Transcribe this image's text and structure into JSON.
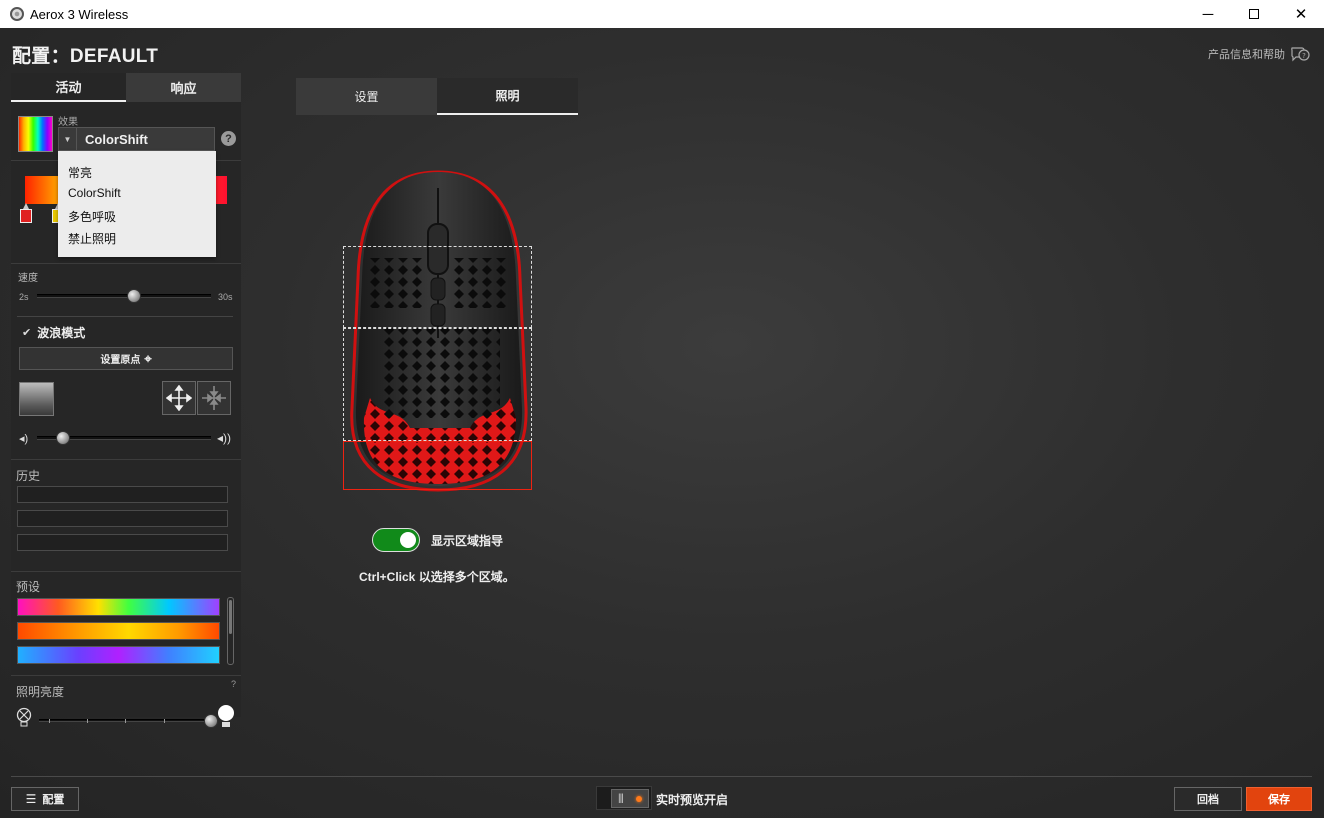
{
  "window": {
    "title": "Aerox 3 Wireless",
    "minimize": "─",
    "close": "✕"
  },
  "header": {
    "profile_title": "配置：DEFAULT",
    "help_link": "产品信息和帮助"
  },
  "left_tabs": [
    {
      "label": "活动",
      "active": true
    },
    {
      "label": "响应",
      "active": false
    }
  ],
  "effect": {
    "label": "效果",
    "selected": "ColorShift",
    "help": "?",
    "options": [
      "常亮",
      "ColorShift",
      "多色呼吸",
      "禁止照明"
    ]
  },
  "speed": {
    "label": "速度",
    "min": "2s",
    "max": "30s",
    "value_fraction": 0.56
  },
  "wave": {
    "label": "波浪模式",
    "checked": true,
    "set_origin": "设置原点"
  },
  "wave_intensity": {
    "value_fraction": 0.15
  },
  "history": {
    "label": "历史"
  },
  "presets": {
    "label": "预设"
  },
  "brightness": {
    "label": "照明亮度",
    "help": "?",
    "value_fraction": 1.0
  },
  "center_tabs": [
    {
      "label": "设置",
      "active": false
    },
    {
      "label": "照明",
      "active": true
    }
  ],
  "zone_guide": {
    "label": "显示区域指导",
    "enabled": true
  },
  "hint": "Ctrl+Click 以选择多个区域。",
  "bottom": {
    "config_button": "配置",
    "live_preview": "实时预览开启",
    "revert_button": "回档",
    "save_button": "保存"
  },
  "colors": {
    "accent_orange": "#e2440e",
    "toggle_green": "#118a1a",
    "zone_red": "#e21"
  },
  "icons": {
    "help_chat": "chat-help-icon",
    "origin": "crosshair-icon",
    "expand": "arrows-out-icon",
    "collapse": "arrows-in-icon"
  }
}
